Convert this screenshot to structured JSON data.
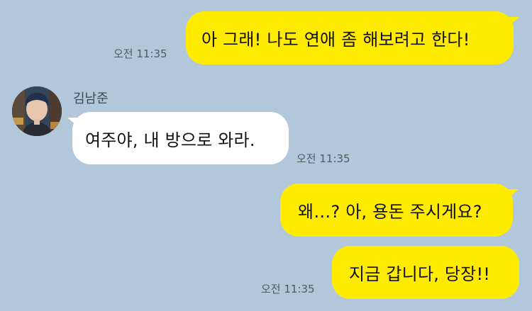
{
  "chat": {
    "messages": [
      {
        "side": "mine",
        "text": "아 그래! 나도 연애 좀 해보려고 한다!",
        "time": "오전 11:35"
      },
      {
        "side": "theirs",
        "sender": "김남준",
        "text": "여주야, 내 방으로 와라.",
        "time": "오전 11:35"
      },
      {
        "side": "mine",
        "text": "왜…? 아, 용돈 주시게요?"
      },
      {
        "side": "mine",
        "text": "지금 갑니다, 당장!!",
        "time": "오전 11:35"
      }
    ]
  },
  "colors": {
    "background": "#b2c7d9",
    "my_bubble": "#ffeb00",
    "their_bubble": "#ffffff"
  },
  "icons": {
    "avatar": "profile-photo"
  }
}
